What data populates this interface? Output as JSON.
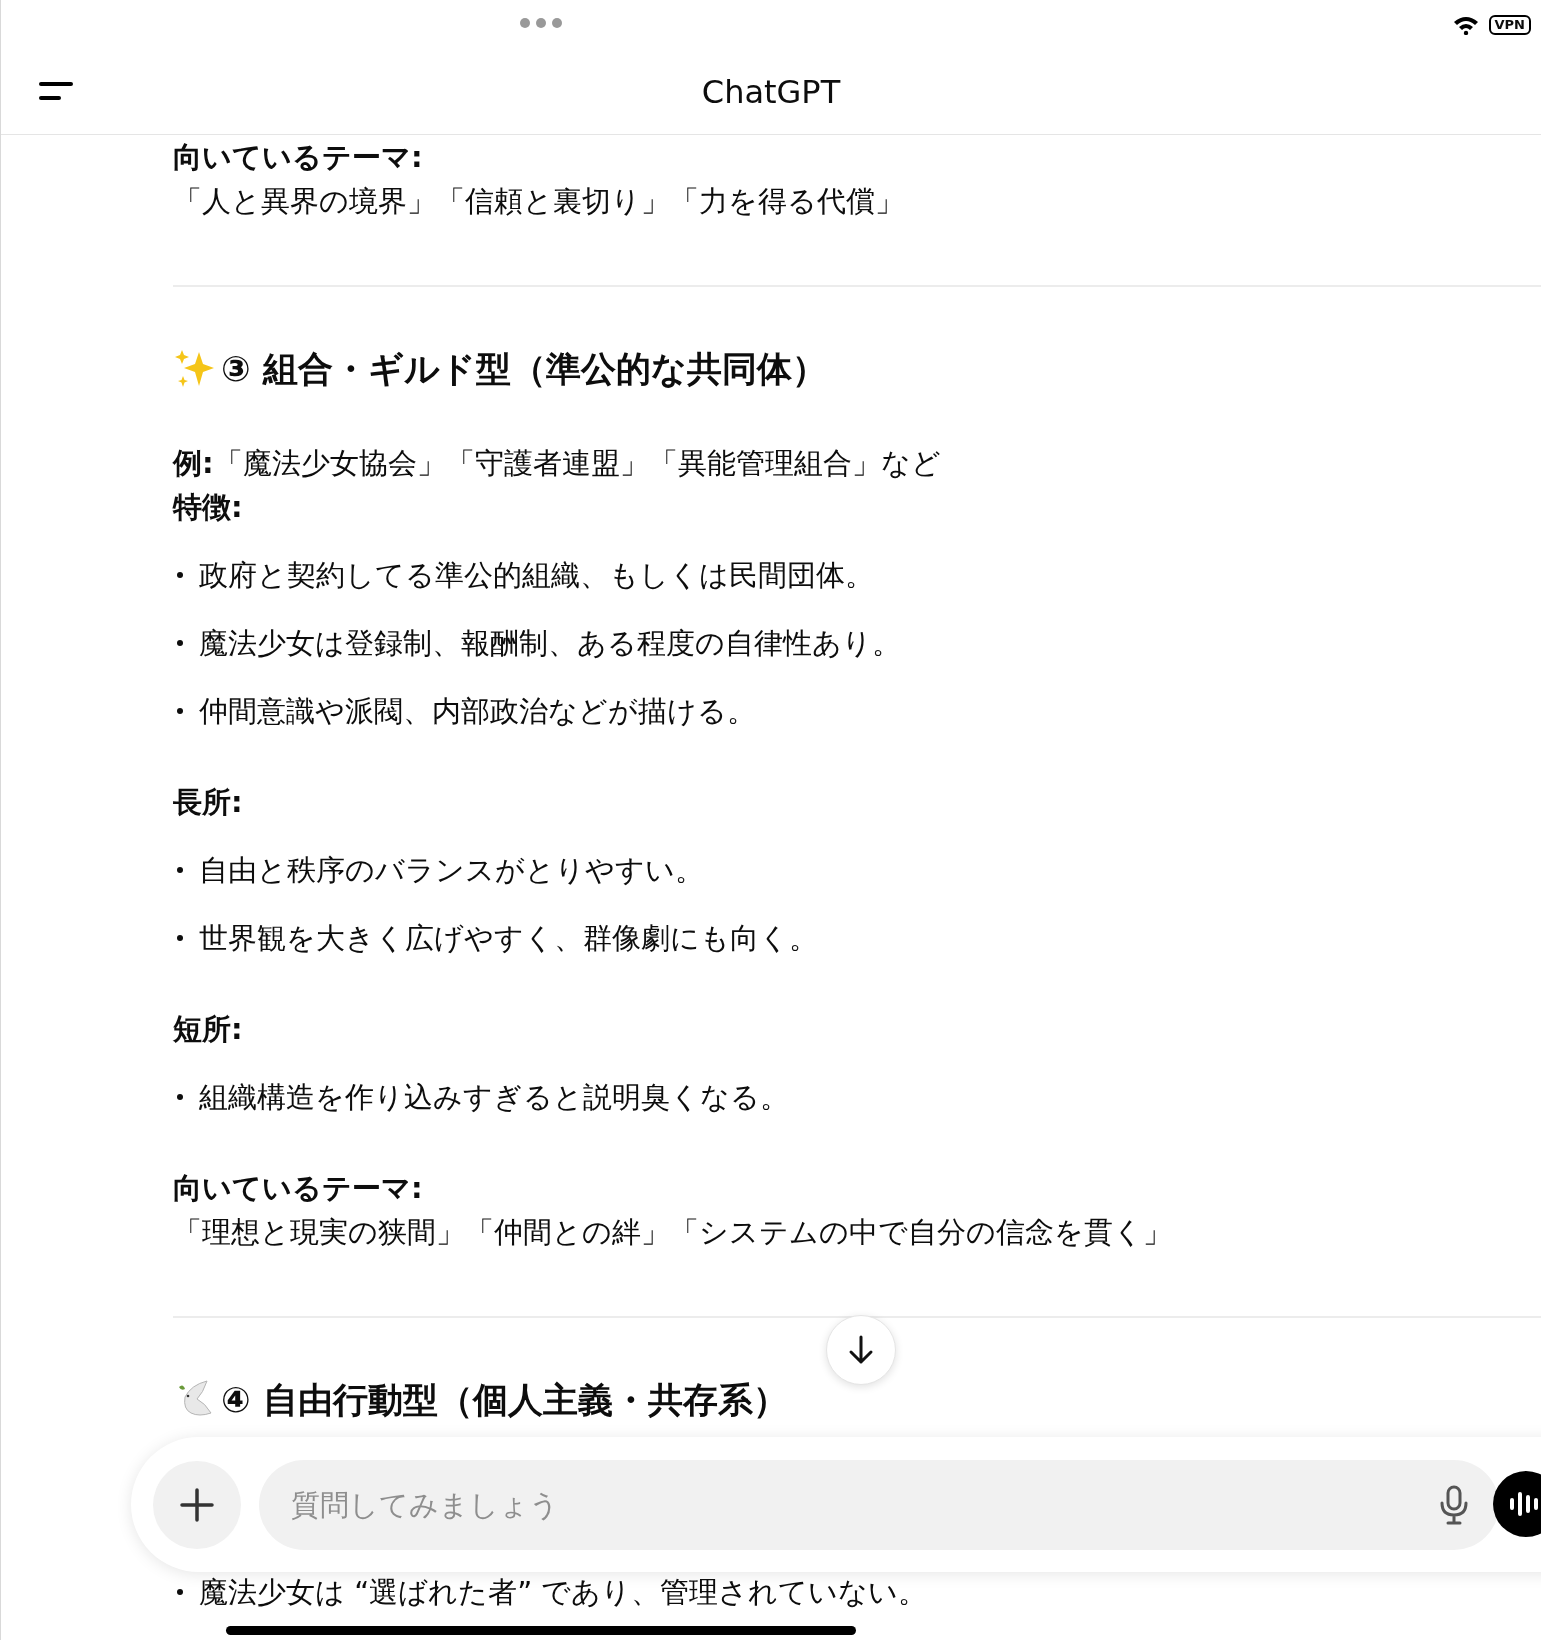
{
  "status_bar": {
    "vpn": "VPN"
  },
  "header": {
    "title": "ChatGPT"
  },
  "blocks": [
    {
      "kind": "para",
      "lines": [
        "**向いているテーマ:**",
        "「人と異界の境界」「信頼と裏切り」「力を得る代償」"
      ]
    },
    {
      "kind": "divider"
    },
    {
      "kind": "heading",
      "text": "③ 組合・ギルド型（準公的な共同体）"
    },
    {
      "kind": "para",
      "lines": [
        "**例:**「魔法少女協会」「守護者連盟」「異能管理組合」など",
        "**特徴:**"
      ]
    },
    {
      "kind": "bullet",
      "text": "政府と契約してる準公的組織、もしくは民間団体。"
    },
    {
      "kind": "bullet",
      "text": "魔法少女は登録制、報酬制、ある程度の自律性あり。"
    },
    {
      "kind": "bullet",
      "text": "仲間意識や派閥、内部政治などが描ける。"
    },
    {
      "kind": "para",
      "lines": [
        "**長所:**"
      ]
    },
    {
      "kind": "bullet",
      "text": "自由と秩序のバランスがとりやすい。"
    },
    {
      "kind": "bullet",
      "text": "世界観を大きく広げやすく、群像劇にも向く。"
    },
    {
      "kind": "para",
      "lines": [
        "**短所:**"
      ]
    },
    {
      "kind": "bullet",
      "text": "組織構造を作り込みすぎると説明臭くなる。"
    },
    {
      "kind": "para",
      "lines": [
        "**向いているテーマ:**",
        "「理想と現実の狭間」「仲間との絆」「システムの中で自分の信念を貫く」"
      ]
    },
    {
      "kind": "divider"
    },
    {
      "kind": "heading",
      "text": "④ 自由行動型（個人主義・共存系）"
    }
  ],
  "composer": {
    "placeholder": "質問してみましょう"
  },
  "after": [
    {
      "kind": "bullet",
      "text": "魔法少女は “選ばれた者” であり、管理されていない。"
    }
  ]
}
